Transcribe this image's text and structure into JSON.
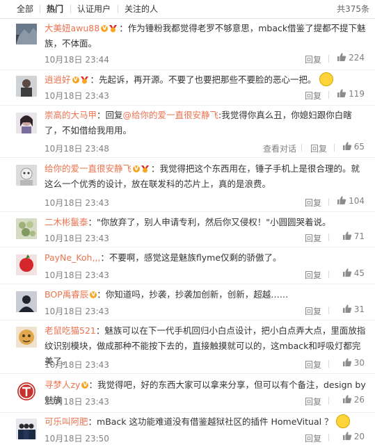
{
  "tabs": [
    "全部",
    "热门",
    "认证用户",
    "关注的人"
  ],
  "active_tab": 1,
  "total": "共375条",
  "actions": {
    "reply": "回复",
    "view_convo": "查看对话"
  },
  "icons": {
    "vip": "vip-badge-icon",
    "medal": "member-medal-icon",
    "like": "thumbs-up-icon"
  },
  "colors": {
    "username": "#eb7350",
    "meta": "#808080",
    "badge": "#f5a623"
  },
  "comments": [
    {
      "user": "大美妞awu88",
      "text": "：作为锤粉我都觉得老罗不够意思，mback借鉴了提都不提下魅族，不体面。",
      "time": "10月18日 23:44",
      "likes": "224"
    },
    {
      "user": "逍逍好",
      "text": "：先起诉，再开源。不要了也要把那些不要脸的恶心一把。",
      "time": "10月18日 23:43",
      "likes": "119"
    },
    {
      "user": "崇高的大马甲",
      "pre": "：回复",
      "mention": "@给你的爱一直很安静飞",
      "text": ":我觉得你真么丑，你媳妇跟你白瞎了，不如借给我用用。",
      "time": "10月18日 23:48",
      "likes": "65"
    },
    {
      "user": "给你的爱一直很安静飞",
      "text": "：我觉得把这个东西用在，锤子手机上是很合理的。就这么一个优秀的设计，放在联发科的芯片上，真的是浪费。",
      "time": "10月18日 23:43",
      "likes": "104"
    },
    {
      "user": "二木彬鬣泰",
      "text": "：\"你放弃了，别人申请专利，然后你又侵权！\"小圆圆哭着说。",
      "time": "10月18日 23:43",
      "likes": "71"
    },
    {
      "user": "PayNe_Koh,,,",
      "text": "：不要啊，感觉这是魅族flyme仅剩的骄傲了。",
      "time": "10月18日 23:43",
      "likes": "45"
    },
    {
      "user": "BOP禹睿辰",
      "text": "：你知道吗，抄袭，抄袭加创新，创新，超越……",
      "time": "10月18日 23:43",
      "likes": "31"
    },
    {
      "user": "老鼠吃猫521",
      "text": "：魅族可以在下一代手机回归小白点设计，把小白点弄大点，里面放指纹识别模块，做成那种不能按下去的，直接触摸就可以的，这mback和呼吸灯都完美了。",
      "time": "10月18日 23:43",
      "likes": "30"
    },
    {
      "user": "寻梦人zy",
      "text": "：我觉得吧，好的东西大家可以拿来分享，但可以有个备注，design by 魅族",
      "time": "10月18日 23:43",
      "likes": "26"
    },
    {
      "user": "可乐叫阿肥",
      "text": "：mBack 这功能难道没有借鉴越狱社区的插件 HomeVitual ？",
      "time": "10月18日 23:50",
      "likes": "20"
    }
  ]
}
